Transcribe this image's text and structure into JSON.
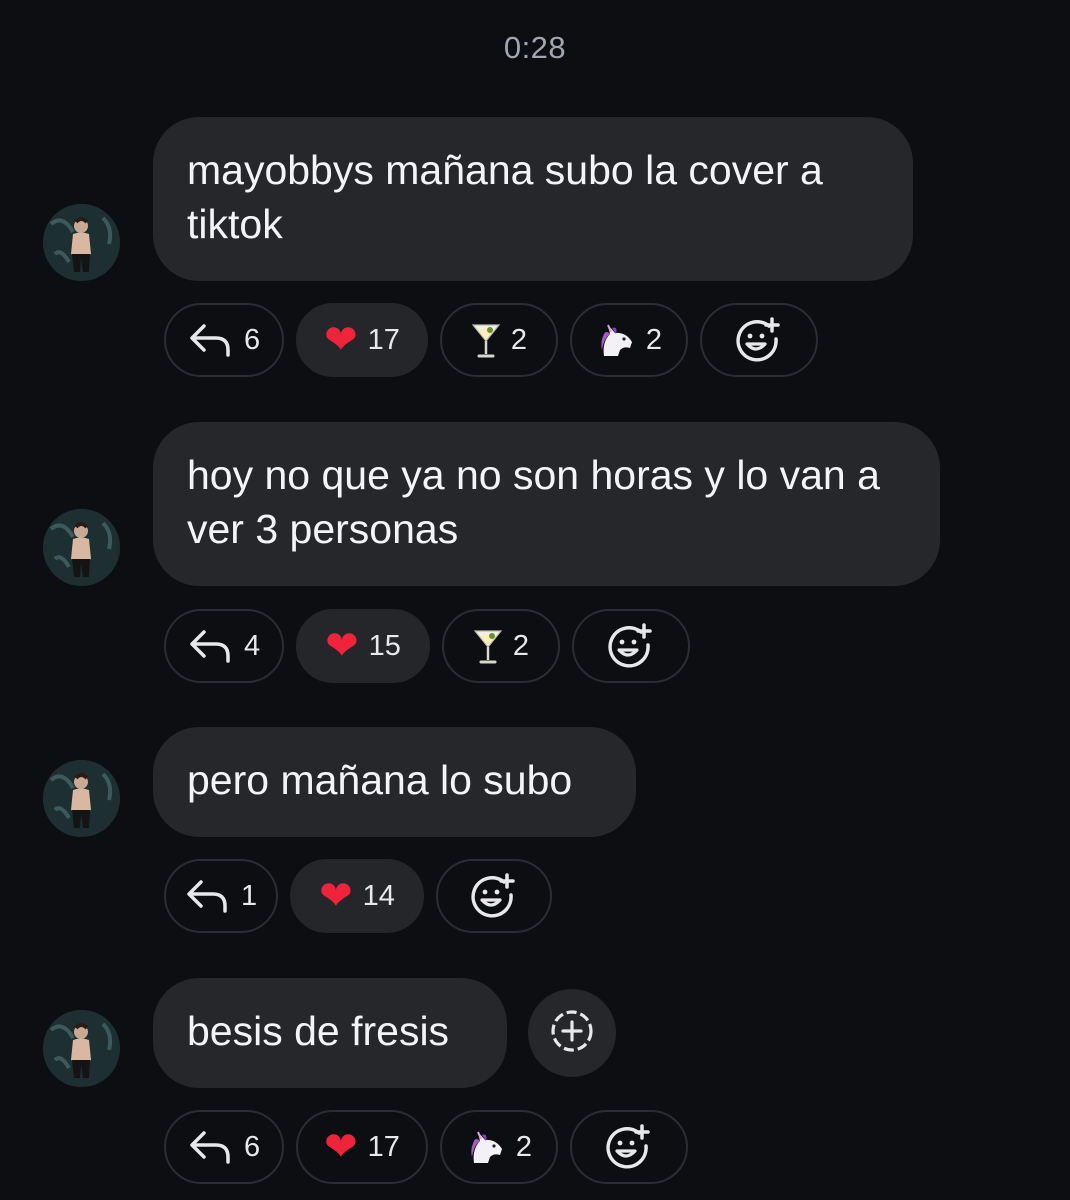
{
  "timestamp": "0:28",
  "messages": [
    {
      "text": "mayobbys mañana subo la cover a tiktok",
      "reactions": [
        {
          "type": "reply",
          "count": "6"
        },
        {
          "type": "heart",
          "emoji": "❤",
          "count": "17"
        },
        {
          "type": "cocktail",
          "emoji": "🍸",
          "count": "2"
        },
        {
          "type": "unicorn",
          "emoji": "🦄",
          "count": "2"
        },
        {
          "type": "add-reaction"
        }
      ]
    },
    {
      "text": "hoy no que ya no son horas y lo van a ver 3 personas",
      "reactions": [
        {
          "type": "reply",
          "count": "4"
        },
        {
          "type": "heart",
          "emoji": "❤",
          "count": "15"
        },
        {
          "type": "cocktail",
          "emoji": "🍸",
          "count": "2"
        },
        {
          "type": "add-reaction"
        }
      ]
    },
    {
      "text": "pero mañana lo subo",
      "reactions": [
        {
          "type": "reply",
          "count": "1"
        },
        {
          "type": "heart",
          "emoji": "❤",
          "count": "14"
        },
        {
          "type": "add-reaction"
        }
      ]
    },
    {
      "text": "besis de fresis",
      "reactions": [
        {
          "type": "reply",
          "count": "6"
        },
        {
          "type": "heart",
          "emoji": "❤",
          "count": "17"
        },
        {
          "type": "unicorn",
          "emoji": "🦄",
          "count": "2"
        },
        {
          "type": "add-reaction"
        }
      ]
    }
  ],
  "colors": {
    "background": "#0d0e12",
    "bubble": "#26272b",
    "heart": "#f0233c"
  }
}
